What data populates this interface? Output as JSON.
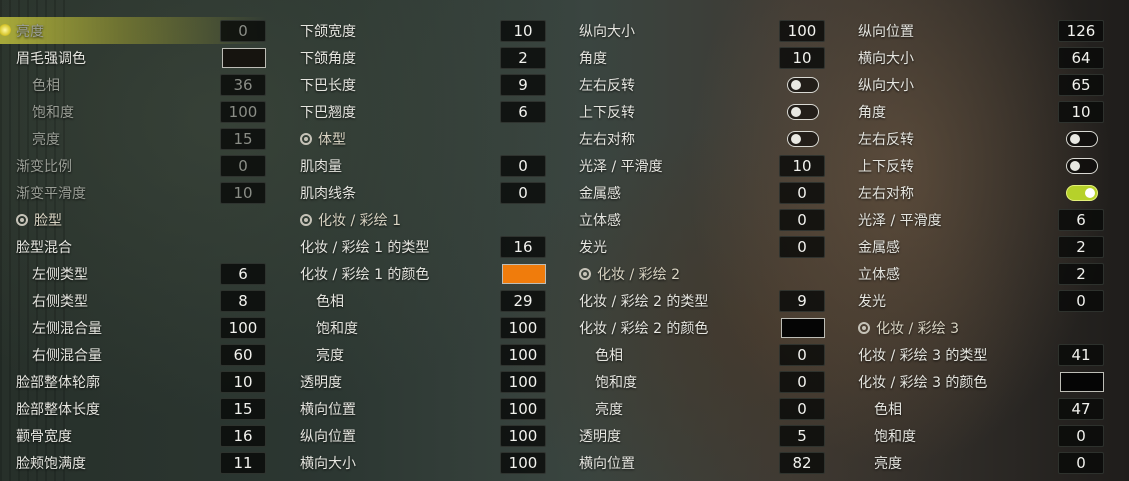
{
  "columns": [
    [
      {
        "label": "亮度",
        "value": "0",
        "dim": true,
        "selected": true
      },
      {
        "label": "眉毛强调色",
        "swatch": "#16140f"
      },
      {
        "label": "色相",
        "value": "36",
        "indent": true,
        "dim": true
      },
      {
        "label": "饱和度",
        "value": "100",
        "indent": true,
        "dim": true
      },
      {
        "label": "亮度",
        "value": "15",
        "indent": true,
        "dim": true
      },
      {
        "label": "渐变比例",
        "value": "0",
        "dim": true
      },
      {
        "label": "渐变平滑度",
        "value": "10",
        "dim": true
      },
      {
        "label": "脸型",
        "section": true
      },
      {
        "label": "脸型混合"
      },
      {
        "label": "左侧类型",
        "value": "6",
        "indent": true
      },
      {
        "label": "右侧类型",
        "value": "8",
        "indent": true
      },
      {
        "label": "左侧混合量",
        "value": "100",
        "indent": true
      },
      {
        "label": "右侧混合量",
        "value": "60",
        "indent": true
      },
      {
        "label": "脸部整体轮廓",
        "value": "10"
      },
      {
        "label": "脸部整体长度",
        "value": "15"
      },
      {
        "label": "颧骨宽度",
        "value": "16"
      },
      {
        "label": "脸颊饱满度",
        "value": "11"
      }
    ],
    [
      {
        "label": "下颌宽度",
        "value": "10"
      },
      {
        "label": "下颌角度",
        "value": "2"
      },
      {
        "label": "下巴长度",
        "value": "9"
      },
      {
        "label": "下巴翘度",
        "value": "6"
      },
      {
        "label": "体型",
        "section": true
      },
      {
        "label": "肌肉量",
        "value": "0"
      },
      {
        "label": "肌肉线条",
        "value": "0"
      },
      {
        "label": "化妆 / 彩绘 1",
        "section": true
      },
      {
        "label": "化妆 / 彩绘 1 的类型",
        "value": "16"
      },
      {
        "label": "化妆 / 彩绘 1 的颜色",
        "swatch": "#f07c0c"
      },
      {
        "label": "色相",
        "value": "29",
        "indent": true
      },
      {
        "label": "饱和度",
        "value": "100",
        "indent": true
      },
      {
        "label": "亮度",
        "value": "100",
        "indent": true
      },
      {
        "label": "透明度",
        "value": "100"
      },
      {
        "label": "横向位置",
        "value": "100"
      },
      {
        "label": "纵向位置",
        "value": "100"
      },
      {
        "label": "横向大小",
        "value": "100"
      }
    ],
    [
      {
        "label": "纵向大小",
        "value": "100"
      },
      {
        "label": "角度",
        "value": "10"
      },
      {
        "label": "左右反转",
        "toggle": false
      },
      {
        "label": "上下反转",
        "toggle": false
      },
      {
        "label": "左右对称",
        "toggle": false
      },
      {
        "label": "光泽 / 平滑度",
        "value": "10"
      },
      {
        "label": "金属感",
        "value": "0"
      },
      {
        "label": "立体感",
        "value": "0"
      },
      {
        "label": "发光",
        "value": "0"
      },
      {
        "label": "化妆 / 彩绘 2",
        "section": true
      },
      {
        "label": "化妆 / 彩绘 2 的类型",
        "value": "9"
      },
      {
        "label": "化妆 / 彩绘 2 的颜色",
        "swatch": "#050505"
      },
      {
        "label": "色相",
        "value": "0",
        "indent": true
      },
      {
        "label": "饱和度",
        "value": "0",
        "indent": true
      },
      {
        "label": "亮度",
        "value": "0",
        "indent": true
      },
      {
        "label": "透明度",
        "value": "5"
      },
      {
        "label": "横向位置",
        "value": "82"
      }
    ],
    [
      {
        "label": "纵向位置",
        "value": "126"
      },
      {
        "label": "横向大小",
        "value": "64"
      },
      {
        "label": "纵向大小",
        "value": "65"
      },
      {
        "label": "角度",
        "value": "10"
      },
      {
        "label": "左右反转",
        "toggle": false
      },
      {
        "label": "上下反转",
        "toggle": false
      },
      {
        "label": "左右对称",
        "toggle": true
      },
      {
        "label": "光泽 / 平滑度",
        "value": "6"
      },
      {
        "label": "金属感",
        "value": "2"
      },
      {
        "label": "立体感",
        "value": "2"
      },
      {
        "label": "发光",
        "value": "0"
      },
      {
        "label": "化妆 / 彩绘 3",
        "section": true
      },
      {
        "label": "化妆 / 彩绘 3 的类型",
        "value": "41"
      },
      {
        "label": "化妆 / 彩绘 3 的颜色",
        "swatch": "#050505"
      },
      {
        "label": "色相",
        "value": "47",
        "indent": true
      },
      {
        "label": "饱和度",
        "value": "0",
        "indent": true
      },
      {
        "label": "亮度",
        "value": "0",
        "indent": true
      }
    ]
  ]
}
